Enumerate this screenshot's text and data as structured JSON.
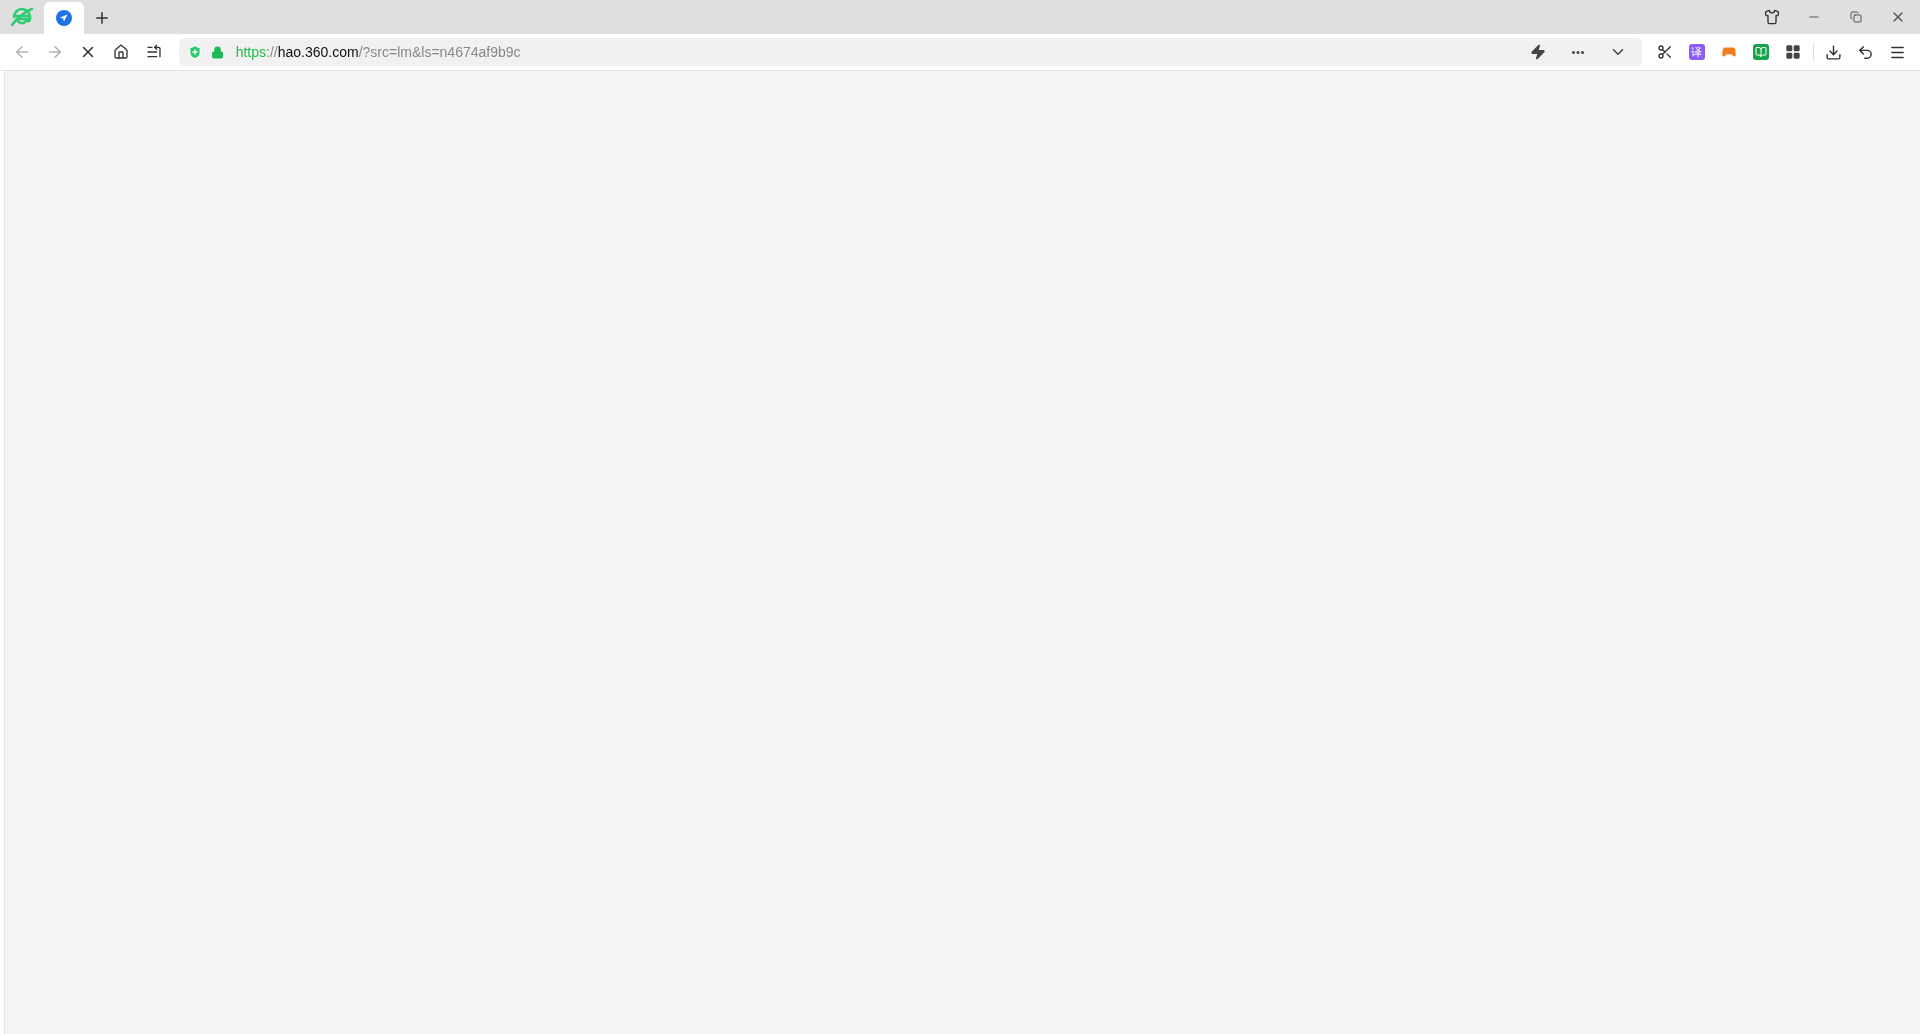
{
  "tabs": [
    {
      "selected": true
    }
  ],
  "toolbar": {
    "back_disabled": true,
    "forward_disabled": true,
    "loading": true
  },
  "address": {
    "scheme": "https",
    "separator": "://",
    "host": "hao.360.com",
    "path": "/?src=lm&ls=n4674af9b9c"
  },
  "extensions": {
    "translate_label": "译"
  }
}
